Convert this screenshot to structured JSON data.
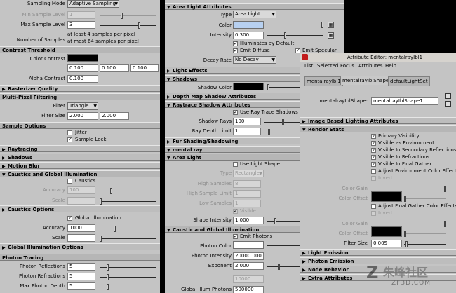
{
  "colors": {
    "panel": "#c4c4c4",
    "black": "#000000",
    "light_color": "#b7d0f0",
    "white": "#ffffff"
  },
  "left": {
    "sampling_mode_label": "Sampling Mode",
    "sampling_mode_value": "Adaptive Sampling",
    "min_sample_label": "Min Sample Level",
    "min_sample_value": "1",
    "max_sample_label": "Max Sample Level",
    "max_sample_value": "3",
    "num_samples_label": "Number of Samples",
    "num_samples_line1": "at least 4 samples per pixel",
    "num_samples_line2": "at most 64 samples per pixel",
    "contrast_threshold": "Contrast Threshold",
    "color_contrast_label": "Color Contrast",
    "cc_r": "0.100",
    "cc_g": "0.100",
    "cc_b": "0.100",
    "alpha_contrast_label": "Alpha Contrast",
    "alpha_contrast_value": "0.100",
    "rasterizer_quality": "Rasterizer Quality",
    "multi_pixel_filtering": "Multi-Pixel Filtering",
    "filter_label": "Filter",
    "filter_value": "Triangle",
    "filter_size_label": "Filter Size",
    "filter_size_x": "2.000",
    "filter_size_y": "2.000",
    "sample_options": "Sample Options",
    "jitter": "Jitter",
    "sample_lock": "Sample Lock",
    "raytracing": "Raytracing",
    "shadows": "Shadows",
    "motion_blur": "Motion Blur",
    "caustics_gi": "Caustics and Global Illumination",
    "caustics": "Caustics",
    "accuracy_label": "Accuracy",
    "accuracy_caustic": "100",
    "scale_label": "Scale",
    "caustics_options": "Caustics Options",
    "global_illumination": "Global Illumination",
    "gi_accuracy": "1000",
    "gi_options": "Global Illumination Options",
    "photon_tracing": "Photon Tracing",
    "photon_reflections_label": "Photon Reflections",
    "photon_reflections": "5",
    "photon_refractions_label": "Photon Refractions",
    "photon_refractions": "5",
    "max_photon_depth_label": "Max Photon Depth",
    "max_photon_depth": "5"
  },
  "middle": {
    "area_light_attributes": "Area Light Attributes",
    "type_label": "Type",
    "type_value": "Area Light",
    "color_label": "Color",
    "intensity_label": "Intensity",
    "intensity_value": "0.300",
    "illuminates_by_default": "Illuminates by Default",
    "emit_diffuse": "Emit Diffuse",
    "emit_specular": "Emit Specular",
    "decay_rate_label": "Decay Rate",
    "decay_rate_value": "No Decay",
    "light_effects": "Light Effects",
    "shadows": "Shadows",
    "shadow_color_label": "Shadow Color",
    "depth_map_shadow": "Depth Map Shadow Attributes",
    "raytrace_shadow": "Raytrace Shadow Attributes",
    "use_ray_trace_shadows": "Use Ray Trace Shadows",
    "shadow_rays_label": "Shadow Rays",
    "shadow_rays_value": "100",
    "ray_depth_label": "Ray Depth Limit",
    "ray_depth_value": "1",
    "fur_shading": "Fur Shading/Shadowing",
    "mental_ray": "mental ray",
    "area_light": "Area Light",
    "use_light_shape": "Use Light Shape",
    "mr_type_label": "Type",
    "mr_type_value": "Rectangle",
    "high_samples_label": "High Samples",
    "high_samples_value": "8",
    "high_sample_limit_label": "High Sample Limit",
    "high_sample_limit_value": "1",
    "low_samples_label": "Low Samples",
    "low_samples_value": "1",
    "visible": "Visible",
    "shape_intensity_label": "Shape Intensity",
    "shape_intensity_value": "1.000",
    "caustic_gi": "Caustic and Global Illumination",
    "emit_photons": "Emit Photons",
    "photon_color_label": "Photon Color",
    "photon_intensity_label": "Photon Intensity",
    "photon_intensity_value": "20000.000",
    "exponent_label": "Exponent",
    "exponent_value": "2.000",
    "caustic_photons_value": "10000",
    "global_illum_photons_label": "Global Illum Photons",
    "global_illum_photons_value": "500000"
  },
  "right": {
    "title": "Attribute Editor: mentalrayIbl1",
    "menu": [
      "List",
      "Selected",
      "Focus",
      "Attributes",
      "Help"
    ],
    "tabs": [
      "mentalrayIbl1",
      "mentalrayIblShape1",
      "defaultLightSet"
    ],
    "shape_label": "mentalrayIblShape:",
    "shape_value": "mentalrayIblShape1",
    "ibl_attributes": "Image Based Lighting Attributes",
    "render_stats": "Render Stats",
    "primary_visibility": "Primary Visibility",
    "visible_as_environment": "Visible as Environment",
    "visible_secondary": "Visible In Secondary Reflections",
    "visible_refractions": "Visible In Refractions",
    "visible_final_gather": "Visible In Final Gather",
    "adjust_env_color": "Adjust Environment Color Effects",
    "invert": "Invert",
    "color_gain_label": "Color Gain",
    "color_offset_label": "Color Offset",
    "adjust_fg_color": "Adjust Final Gather Color Effects",
    "filter_size_label": "Filter Size",
    "filter_size_value": "0.005",
    "light_emission": "Light Emission",
    "photon_emission": "Photon Emission",
    "node_behavior": "Node Behavior",
    "extra_attributes": "Extra Attributes"
  },
  "watermark": {
    "cn": "朱峰社区",
    "url": "ZF3D.COM"
  }
}
